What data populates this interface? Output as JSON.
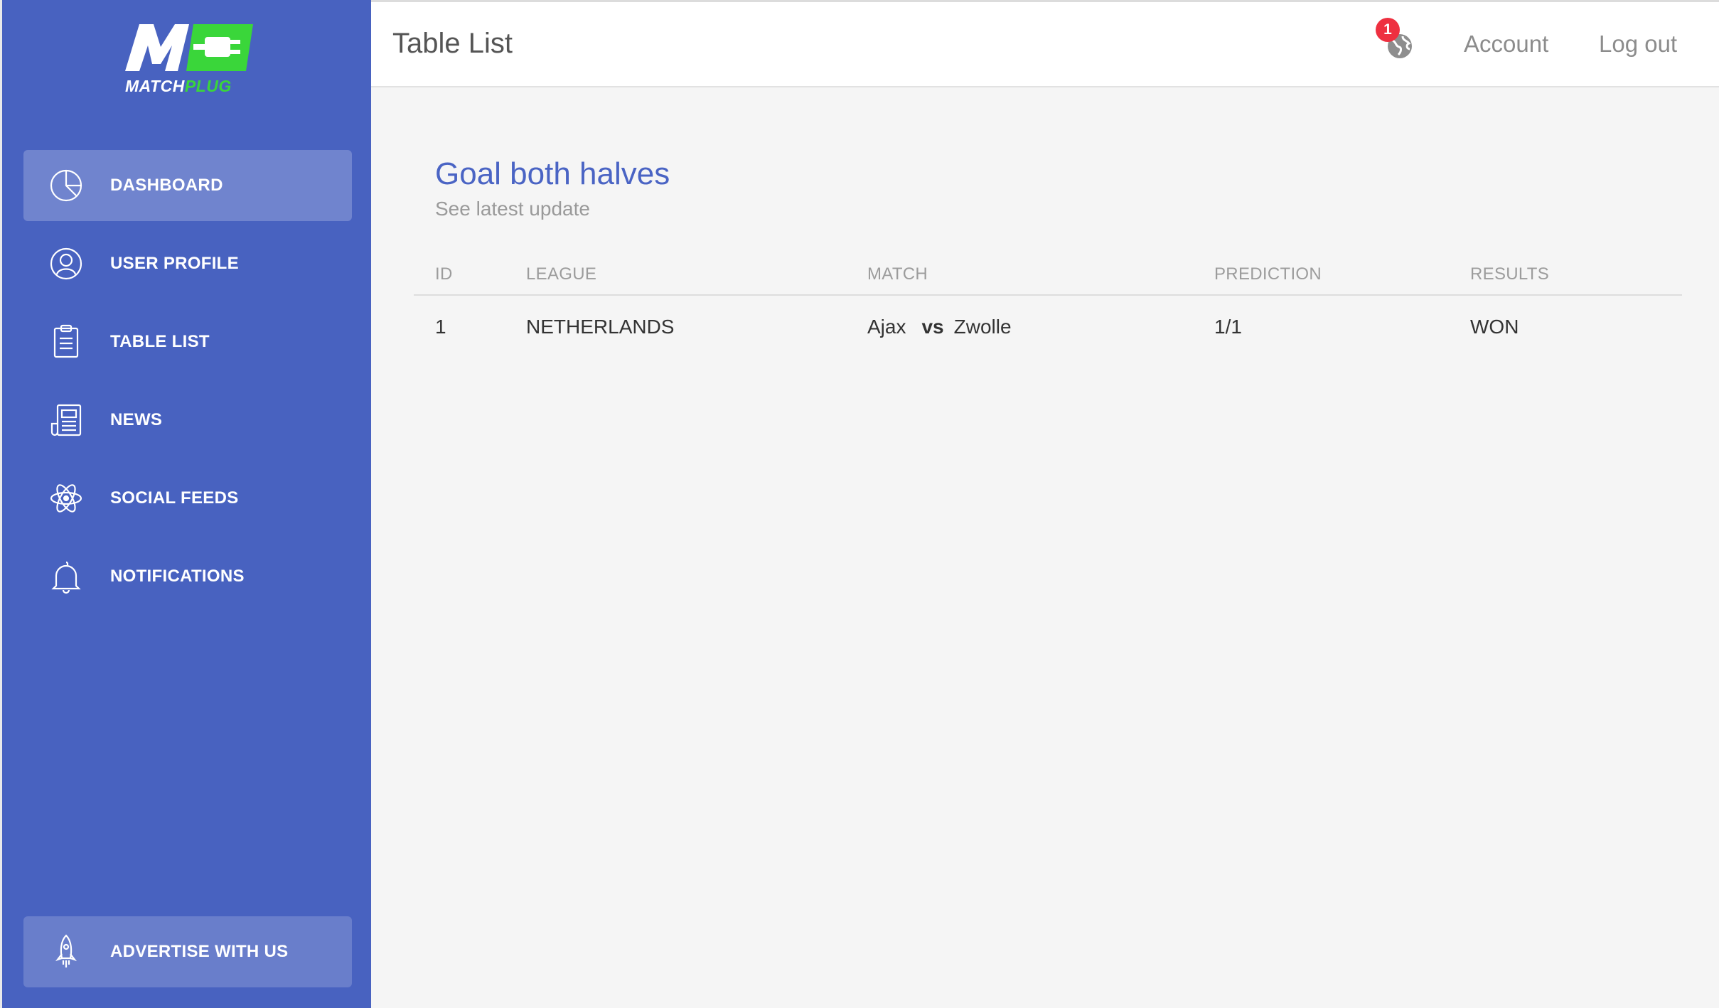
{
  "brand": {
    "logo_mark": "MC",
    "name_part1": "MATCH",
    "name_part2": "PLUG",
    "colors": {
      "primary": "#4862c0",
      "accent": "#3ad63a"
    }
  },
  "sidebar": {
    "items": [
      {
        "label": "DASHBOARD",
        "icon": "pie-chart-icon",
        "active": true
      },
      {
        "label": "USER PROFILE",
        "icon": "user-icon",
        "active": false
      },
      {
        "label": "TABLE LIST",
        "icon": "clipboard-icon",
        "active": false
      },
      {
        "label": "NEWS",
        "icon": "newspaper-icon",
        "active": false
      },
      {
        "label": "SOCIAL FEEDS",
        "icon": "atom-icon",
        "active": false
      },
      {
        "label": "NOTIFICATIONS",
        "icon": "bell-icon",
        "active": false
      }
    ],
    "advertise": {
      "label": "ADVERTISE WITH US",
      "icon": "rocket-icon"
    }
  },
  "header": {
    "title": "Table List",
    "notifications": {
      "count": "1",
      "icon": "globe-icon"
    },
    "account_label": "Account",
    "logout_label": "Log out"
  },
  "main": {
    "title": "Goal both halves",
    "subtitle": "See latest update",
    "table": {
      "columns": [
        "ID",
        "LEAGUE",
        "MATCH",
        "PREDICTION",
        "RESULTS"
      ],
      "rows": [
        {
          "id": "1",
          "league": "NETHERLANDS",
          "home": "Ajax",
          "vs": "vs",
          "away": "Zwolle",
          "prediction": "1/1",
          "result": "WON"
        }
      ]
    }
  }
}
